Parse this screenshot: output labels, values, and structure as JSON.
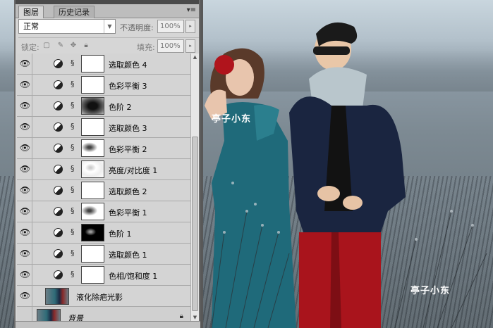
{
  "panel": {
    "tabs": [
      {
        "label": "图层",
        "active": true
      },
      {
        "label": "历史记录",
        "active": false
      }
    ],
    "menu_icon": "panel-menu-icon",
    "blend_mode": "正常",
    "opacity_label": "不透明度:",
    "opacity_value": "100%",
    "lock_label": "锁定:",
    "fill_label": "填充:",
    "fill_value": "100%"
  },
  "layers": [
    {
      "name": "选取颜色 4",
      "type": "adjustment",
      "mask": "white",
      "visible": true
    },
    {
      "name": "色彩平衡 3",
      "type": "adjustment",
      "mask": "white",
      "visible": true
    },
    {
      "name": "色阶 2",
      "type": "adjustment",
      "mask": "dark",
      "visible": true
    },
    {
      "name": "选取颜色 3",
      "type": "adjustment",
      "mask": "white",
      "visible": true
    },
    {
      "name": "色彩平衡 2",
      "type": "adjustment",
      "mask": "soft",
      "visible": true
    },
    {
      "name": "亮度/对比度 1",
      "type": "adjustment",
      "mask": "soft2",
      "visible": true
    },
    {
      "name": "选取颜色 2",
      "type": "adjustment",
      "mask": "white",
      "visible": true
    },
    {
      "name": "色彩平衡 1",
      "type": "adjustment",
      "mask": "soft",
      "visible": true
    },
    {
      "name": "色阶 1",
      "type": "adjustment",
      "mask": "black",
      "visible": true
    },
    {
      "name": "选取颜色 1",
      "type": "adjustment",
      "mask": "white",
      "visible": true
    },
    {
      "name": "色相/饱和度 1",
      "type": "adjustment",
      "mask": "white",
      "visible": true
    },
    {
      "name": "液化除疤光影",
      "type": "raster",
      "visible": true
    },
    {
      "name": "背景",
      "type": "background",
      "visible": false,
      "locked": true
    }
  ],
  "watermark": {
    "title": "亭子小东"
  }
}
